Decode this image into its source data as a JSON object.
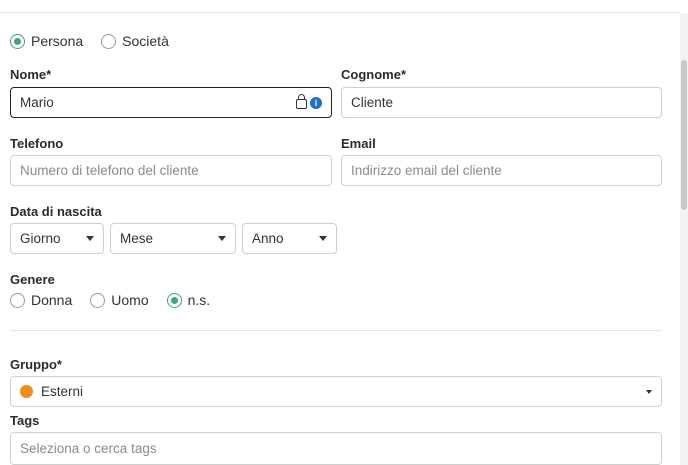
{
  "entity_type": {
    "options": [
      {
        "label": "Persona",
        "selected": true
      },
      {
        "label": "Società",
        "selected": false
      }
    ]
  },
  "fields": {
    "nome": {
      "label": "Nome*",
      "value": "Mario"
    },
    "cognome": {
      "label": "Cognome*",
      "value": "Cliente"
    },
    "telefono": {
      "label": "Telefono",
      "placeholder": "Numero di telefono del cliente"
    },
    "email": {
      "label": "Email",
      "placeholder": "Indirizzo email del cliente"
    },
    "data_nascita": {
      "label": "Data di nascita",
      "giorno": "Giorno",
      "mese": "Mese",
      "anno": "Anno"
    },
    "genere": {
      "label": "Genere",
      "options": [
        {
          "label": "Donna",
          "selected": false
        },
        {
          "label": "Uomo",
          "selected": false
        },
        {
          "label": "n.s.",
          "selected": true
        }
      ]
    },
    "gruppo": {
      "label": "Gruppo*",
      "value": "Esterni",
      "dot_color": "#f08a1c"
    },
    "tags": {
      "label": "Tags",
      "placeholder": "Seleziona o cerca tags"
    }
  },
  "icons": {
    "password_manager": "lock-icon",
    "info": "info-icon",
    "info_glyph": "i"
  },
  "colors": {
    "accent": "#3aa876",
    "info_blue": "#1f6fd1"
  }
}
